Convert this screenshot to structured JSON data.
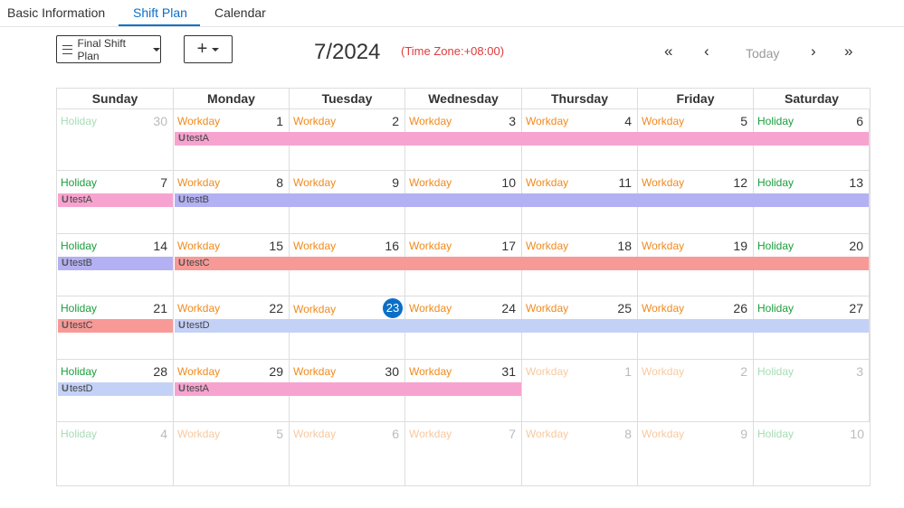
{
  "tabs": [
    {
      "label": "Basic Information"
    },
    {
      "label": "Shift Plan"
    },
    {
      "label": "Calendar"
    }
  ],
  "toolbar": {
    "plan_select": "Final Shift Plan",
    "add_label": "+"
  },
  "header": {
    "month": "7/2024",
    "timezone": "(Time Zone:+08:00)",
    "nav": {
      "first": "«",
      "prev": "‹",
      "today": "Today",
      "next": "›",
      "last": "»"
    }
  },
  "weekdays": [
    "Sunday",
    "Monday",
    "Tuesday",
    "Wednesday",
    "Thursday",
    "Friday",
    "Saturday"
  ],
  "shift_prefix": "U",
  "colors": {
    "testA": "#f7a3cf",
    "testB": "#b3b0f3",
    "testC": "#f79a97",
    "testD": "#c4d1f7",
    "workday": "#f08a1d",
    "holiday": "#1a9e3c",
    "accent": "#0b6fc7"
  },
  "weeks": [
    {
      "days": [
        {
          "day": "30",
          "status": "Holiday",
          "outside": true
        },
        {
          "day": "1",
          "status": "Workday"
        },
        {
          "day": "2",
          "status": "Workday"
        },
        {
          "day": "3",
          "status": "Workday"
        },
        {
          "day": "4",
          "status": "Workday"
        },
        {
          "day": "5",
          "status": "Workday"
        },
        {
          "day": "6",
          "status": "Holiday"
        }
      ],
      "shifts": [
        {
          "name": "testA",
          "start": 1,
          "end": 6
        }
      ]
    },
    {
      "days": [
        {
          "day": "7",
          "status": "Holiday"
        },
        {
          "day": "8",
          "status": "Workday"
        },
        {
          "day": "9",
          "status": "Workday"
        },
        {
          "day": "10",
          "status": "Workday"
        },
        {
          "day": "11",
          "status": "Workday"
        },
        {
          "day": "12",
          "status": "Workday"
        },
        {
          "day": "13",
          "status": "Holiday"
        }
      ],
      "shifts": [
        {
          "name": "testA",
          "start": 0,
          "end": 0
        },
        {
          "name": "testB",
          "start": 1,
          "end": 6
        }
      ]
    },
    {
      "days": [
        {
          "day": "14",
          "status": "Holiday"
        },
        {
          "day": "15",
          "status": "Workday"
        },
        {
          "day": "16",
          "status": "Workday"
        },
        {
          "day": "17",
          "status": "Workday"
        },
        {
          "day": "18",
          "status": "Workday"
        },
        {
          "day": "19",
          "status": "Workday"
        },
        {
          "day": "20",
          "status": "Holiday"
        }
      ],
      "shifts": [
        {
          "name": "testB",
          "start": 0,
          "end": 0
        },
        {
          "name": "testC",
          "start": 1,
          "end": 6
        }
      ]
    },
    {
      "days": [
        {
          "day": "21",
          "status": "Holiday"
        },
        {
          "day": "22",
          "status": "Workday"
        },
        {
          "day": "23",
          "status": "Workday",
          "today": true
        },
        {
          "day": "24",
          "status": "Workday"
        },
        {
          "day": "25",
          "status": "Workday"
        },
        {
          "day": "26",
          "status": "Workday"
        },
        {
          "day": "27",
          "status": "Holiday"
        }
      ],
      "shifts": [
        {
          "name": "testC",
          "start": 0,
          "end": 0
        },
        {
          "name": "testD",
          "start": 1,
          "end": 6
        }
      ]
    },
    {
      "days": [
        {
          "day": "28",
          "status": "Holiday"
        },
        {
          "day": "29",
          "status": "Workday"
        },
        {
          "day": "30",
          "status": "Workday"
        },
        {
          "day": "31",
          "status": "Workday"
        },
        {
          "day": "1",
          "status": "Workday",
          "outside": true
        },
        {
          "day": "2",
          "status": "Workday",
          "outside": true
        },
        {
          "day": "3",
          "status": "Holiday",
          "outside": true
        }
      ],
      "shifts": [
        {
          "name": "testD",
          "start": 0,
          "end": 0
        },
        {
          "name": "testA",
          "start": 1,
          "end": 3
        }
      ]
    },
    {
      "days": [
        {
          "day": "4",
          "status": "Holiday",
          "outside": true
        },
        {
          "day": "5",
          "status": "Workday",
          "outside": true
        },
        {
          "day": "6",
          "status": "Workday",
          "outside": true
        },
        {
          "day": "7",
          "status": "Workday",
          "outside": true
        },
        {
          "day": "8",
          "status": "Workday",
          "outside": true
        },
        {
          "day": "9",
          "status": "Workday",
          "outside": true
        },
        {
          "day": "10",
          "status": "Holiday",
          "outside": true
        }
      ],
      "shifts": []
    }
  ]
}
